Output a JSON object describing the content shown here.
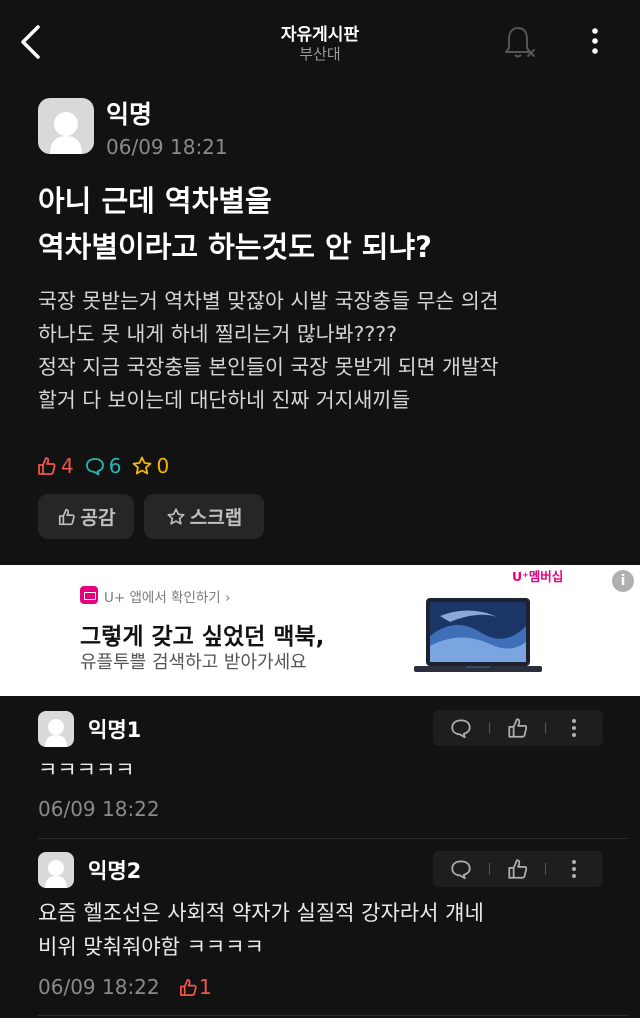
{
  "header": {
    "title": "자유게시판",
    "subtitle": "부산대"
  },
  "post": {
    "author": "익명",
    "date": "06/09 18:21",
    "title_lines": [
      "아니 근데 역차별을",
      "역차별이라고 하는것도 안 되냐?"
    ],
    "body_lines": [
      "국장 못받는거 역차별 맞잖아 시발 국장충들 무슨 의견",
      "하나도 못 내게 하네 찔리는거 많나봐????",
      "정작 지금 국장충들 본인들이 국장 못받게 되면 개발작",
      "할거 다 보이는데 대단하네 진짜 거지새끼들"
    ],
    "stats": {
      "likes": "4",
      "comments": "6",
      "scraps": "0"
    },
    "actions": {
      "like_label": "공감",
      "scrap_label": "스크랩"
    }
  },
  "ad": {
    "badge_text": "U+ 앱에서 확인하기 ›",
    "headline": "그렇게 갖고 싶었던 맥북,",
    "subline": "유플투쁠 검색하고 받아가세요",
    "brand": "U⁺멤버십",
    "info_icon": "i"
  },
  "comments": [
    {
      "author": "익명1",
      "lines": [
        "ㅋㅋㅋㅋㅋ"
      ],
      "date": "06/09 18:22",
      "likes": ""
    },
    {
      "author": "익명2",
      "lines": [
        "요즘 헬조선은 사회적 약자가 실질적 강자라서 걔네",
        "비위 맞춰줘야함 ㅋㅋㅋㅋ"
      ],
      "date": "06/09 18:22",
      "likes": "1"
    }
  ],
  "colors": {
    "background": "#121212",
    "like": "#f0564a",
    "comment": "#27b6b6",
    "scrap": "#f2b705",
    "ad_brand": "#e6007e"
  },
  "icons": {
    "back": "chevron-left-icon",
    "bell": "bell-off-icon",
    "more": "more-vertical-icon",
    "like": "thumbs-up-icon",
    "comment": "comment-bubble-icon",
    "scrap": "star-icon"
  }
}
